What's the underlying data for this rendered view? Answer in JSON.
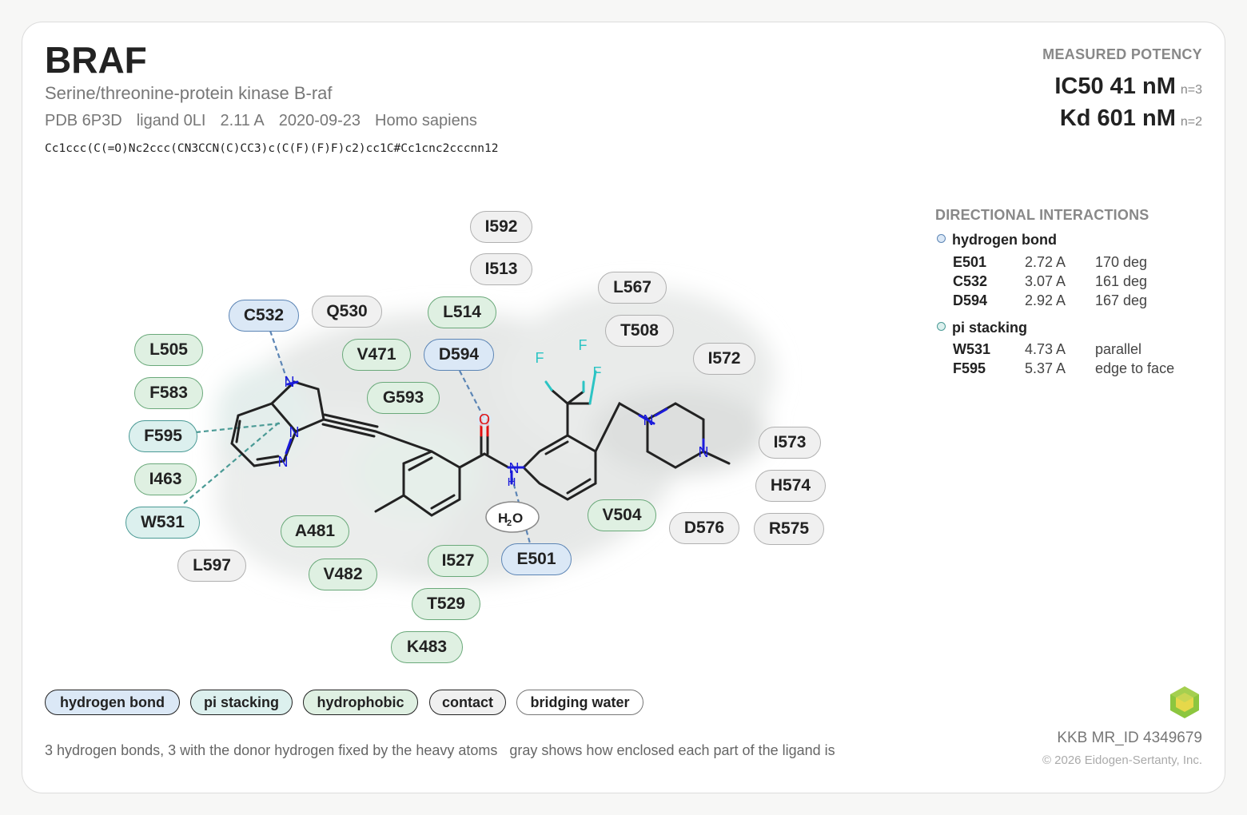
{
  "header": {
    "title": "BRAF",
    "subtitle": "Serine/threonine-protein kinase B-raf",
    "pdb": "PDB 6P3D",
    "ligand": "ligand 0LI",
    "resolution": "2.11 A",
    "date": "2020-09-23",
    "organism": "Homo sapiens",
    "smiles": "Cc1ccc(C(=O)Nc2ccc(CN3CCN(C)CC3)c(C(F)(F)F)c2)cc1C#Cc1cnc2cccnn12"
  },
  "potency": {
    "heading": "MEASURED POTENCY",
    "values": [
      {
        "label": "IC50 41 nM",
        "n": "n=3"
      },
      {
        "label": "Kd 601 nM",
        "n": "n=2"
      }
    ]
  },
  "directional": {
    "heading": "DIRECTIONAL INTERACTIONS",
    "hbond": {
      "title": "hydrogen bond",
      "rows": [
        {
          "res": "E501",
          "dist": "2.72 A",
          "angle": "170 deg"
        },
        {
          "res": "C532",
          "dist": "3.07 A",
          "angle": "161 deg"
        },
        {
          "res": "D594",
          "dist": "2.92 A",
          "angle": "167 deg"
        }
      ]
    },
    "pistack": {
      "title": "pi stacking",
      "rows": [
        {
          "res": "W531",
          "dist": "4.73 A",
          "angle": "parallel"
        },
        {
          "res": "F595",
          "dist": "5.37 A",
          "angle": "edge to face"
        }
      ]
    }
  },
  "residues": [
    {
      "label": "I592",
      "kind": "ct"
    },
    {
      "label": "I513",
      "kind": "ct"
    },
    {
      "label": "L567",
      "kind": "ct"
    },
    {
      "label": "C532",
      "kind": "hb"
    },
    {
      "label": "Q530",
      "kind": "ct"
    },
    {
      "label": "L514",
      "kind": "hp"
    },
    {
      "label": "T508",
      "kind": "ct"
    },
    {
      "label": "L505",
      "kind": "hp"
    },
    {
      "label": "V471",
      "kind": "hp"
    },
    {
      "label": "D594",
      "kind": "hb"
    },
    {
      "label": "I572",
      "kind": "ct"
    },
    {
      "label": "F583",
      "kind": "hp"
    },
    {
      "label": "G593",
      "kind": "hp"
    },
    {
      "label": "F595",
      "kind": "pi"
    },
    {
      "label": "I573",
      "kind": "ct"
    },
    {
      "label": "I463",
      "kind": "hp"
    },
    {
      "label": "H574",
      "kind": "ct"
    },
    {
      "label": "W531",
      "kind": "pi"
    },
    {
      "label": "V504",
      "kind": "hp"
    },
    {
      "label": "D576",
      "kind": "ct"
    },
    {
      "label": "R575",
      "kind": "ct"
    },
    {
      "label": "A481",
      "kind": "hp"
    },
    {
      "label": "E501",
      "kind": "hb"
    },
    {
      "label": "L597",
      "kind": "ct"
    },
    {
      "label": "V482",
      "kind": "hp"
    },
    {
      "label": "I527",
      "kind": "hp"
    },
    {
      "label": "T529",
      "kind": "hp"
    },
    {
      "label": "K483",
      "kind": "hp"
    }
  ],
  "molecule": {
    "atoms": {
      "N": "N",
      "O": "O",
      "F": "F",
      "water_H": "H",
      "water_sub": "2",
      "water_O": "O"
    }
  },
  "legend": {
    "hbond": "hydrogen bond",
    "pistack": "pi stacking",
    "hydrophobic": "hydrophobic",
    "contact": "contact",
    "water": "bridging water"
  },
  "footer": {
    "note1": "3 hydrogen bonds, 3 with the donor hydrogen fixed by the heavy atoms",
    "note2": "gray shows how enclosed each part of the ligand is",
    "mrid": "KKB MR_ID 4349679",
    "copyright": "© 2026 Eidogen-Sertanty, Inc."
  },
  "colors": {
    "hbond": "#5c85b5",
    "pistack": "#4a9a95",
    "hydrophobic": "#6aa97a",
    "contact": "#b0b0b0",
    "nitrogen": "#1a1adb",
    "oxygen": "#e01010",
    "fluorine": "#2cc4c4"
  }
}
